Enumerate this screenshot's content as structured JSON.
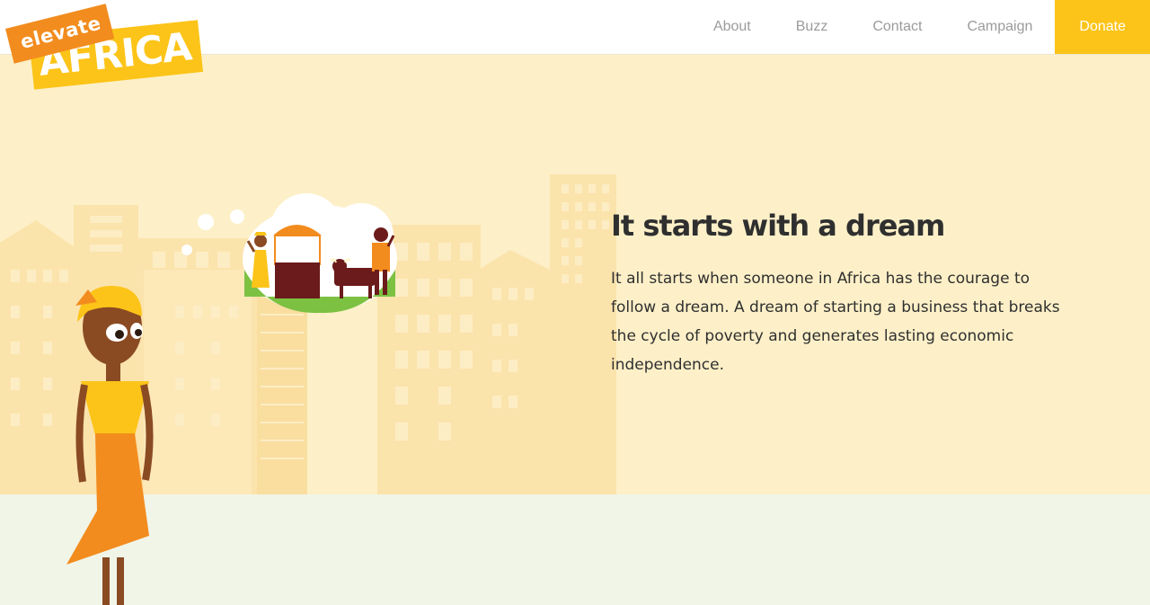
{
  "logo": {
    "line1": "elevate",
    "line2": "AFRICA"
  },
  "nav": {
    "about": "About",
    "buzz": "Buzz",
    "contact": "Contact",
    "campaign": "Campaign",
    "donate": "Donate"
  },
  "hero": {
    "headline": "It starts with a dream",
    "body": "It all starts when someone in Africa has the courage to follow a dream. A dream of starting a business that breaks the cycle of poverty and generates lasting economic independence."
  },
  "colors": {
    "accent_yellow": "#fcc419",
    "accent_orange": "#f28c1e",
    "background": "#fdf0c8",
    "ground": "#f1f5e8",
    "text": "#2f2f2f",
    "nav_text": "#9b9b9b"
  }
}
